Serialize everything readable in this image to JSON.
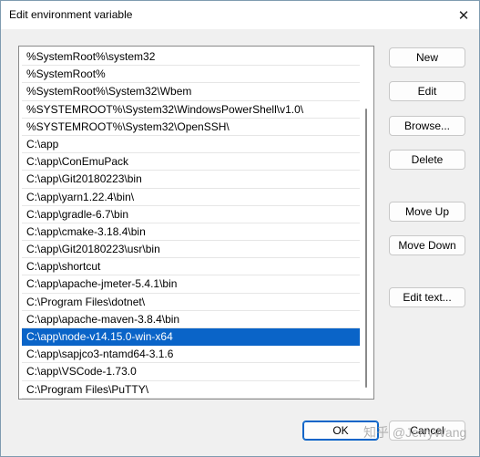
{
  "window": {
    "title": "Edit environment variable",
    "close_glyph": "✕"
  },
  "path_list": {
    "selected_index": 16,
    "items": [
      "%SystemRoot%\\system32",
      "%SystemRoot%",
      "%SystemRoot%\\System32\\Wbem",
      "%SYSTEMROOT%\\System32\\WindowsPowerShell\\v1.0\\",
      "%SYSTEMROOT%\\System32\\OpenSSH\\",
      "C:\\app",
      "C:\\app\\ConEmuPack",
      "C:\\app\\Git20180223\\bin",
      "C:\\app\\yarn1.22.4\\bin\\",
      "C:\\app\\gradle-6.7\\bin",
      "C:\\app\\cmake-3.18.4\\bin",
      "C:\\app\\Git20180223\\usr\\bin",
      "C:\\app\\shortcut",
      "C:\\app\\apache-jmeter-5.4.1\\bin",
      "C:\\Program Files\\dotnet\\",
      "C:\\app\\apache-maven-3.8.4\\bin",
      "C:\\app\\node-v14.15.0-win-x64",
      "C:\\app\\sapjco3-ntamd64-3.1.6",
      "C:\\app\\VSCode-1.73.0",
      "C:\\Program Files\\PuTTY\\"
    ]
  },
  "buttons": {
    "new": "New",
    "edit": "Edit",
    "browse": "Browse...",
    "delete": "Delete",
    "move_up": "Move Up",
    "move_down": "Move Down",
    "edit_text": "Edit text...",
    "ok": "OK",
    "cancel": "Cancel"
  },
  "watermark": "知乎 @JerryWang",
  "colors": {
    "selection": "#0a64c8",
    "accent": "#0a64c8"
  }
}
